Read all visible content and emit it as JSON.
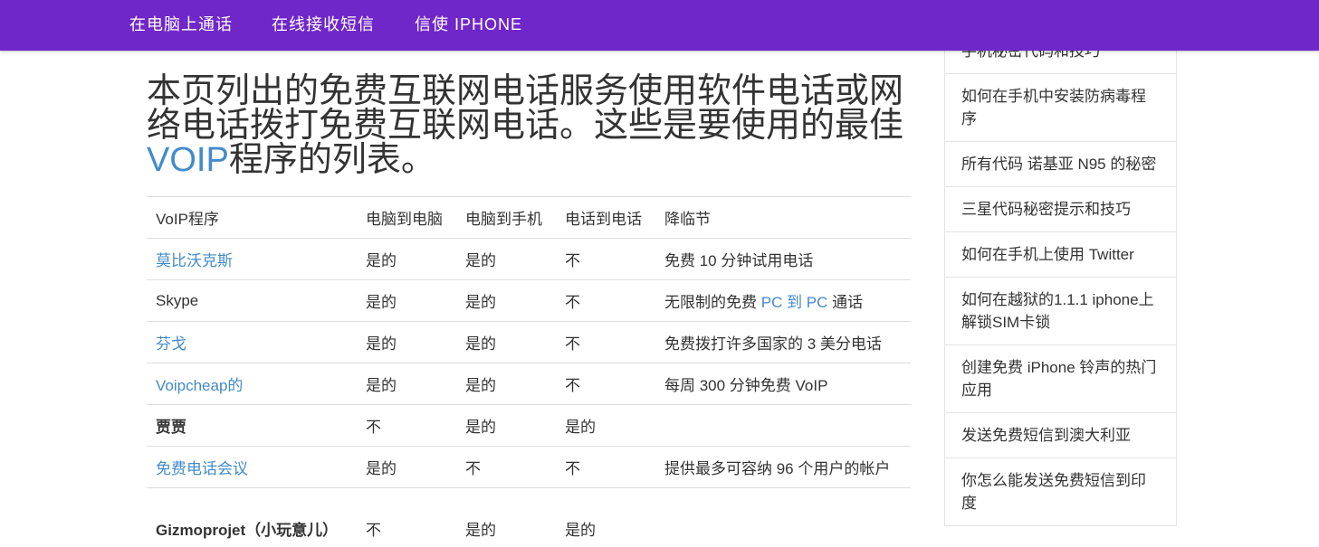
{
  "nav": {
    "items": [
      "在电脑上通话",
      "在线接收短信",
      "信使 IPHONE"
    ]
  },
  "heading": {
    "text_before": "本页列出的免费互联网电话服务使用软件电话或网络电话拨打免费互联网电话。这些是要使用的最佳",
    "link": "VOIP",
    "text_after": "程序的列表。"
  },
  "table": {
    "headers": [
      "VoIP程序",
      "电脑到电脑",
      "电脑到手机",
      "电话到电话",
      "降临节"
    ],
    "rows": [
      {
        "program": "莫比沃克斯",
        "program_link": true,
        "bold": false,
        "pc_pc": "是的",
        "pc_phone": "是的",
        "phone_phone": "不",
        "note": "免费 10 分钟试用电话"
      },
      {
        "program": "Skype",
        "program_link": false,
        "bold": false,
        "pc_pc": "是的",
        "pc_phone": "是的",
        "phone_phone": "不",
        "note_before": "无限制的免费 ",
        "note_link": "PC 到 PC",
        "note_after": " 通话"
      },
      {
        "program": "芬戈",
        "program_link": true,
        "bold": false,
        "pc_pc": "是的",
        "pc_phone": "是的",
        "phone_phone": "不",
        "note": "免费拨打许多国家的 3 美分电话"
      },
      {
        "program": "Voipcheap的",
        "program_link": true,
        "bold": false,
        "pc_pc": "是的",
        "pc_phone": "是的",
        "phone_phone": "不",
        "note": "每周 300 分钟免费 VoIP"
      },
      {
        "program": "贾贾",
        "program_link": false,
        "bold": true,
        "pc_pc": "不",
        "pc_phone": "是的",
        "phone_phone": "是的",
        "note": ""
      },
      {
        "program": "免费电话会议",
        "program_link": true,
        "bold": false,
        "pc_pc": "是的",
        "pc_phone": "不",
        "phone_phone": "不",
        "note": "提供最多可容纳 96 个用户的帐户"
      },
      {
        "program": "Gizmoprojet（小玩意儿）",
        "program_link": false,
        "bold": true,
        "pc_pc": "不",
        "pc_phone": "是的",
        "phone_phone": "是的",
        "note": ""
      }
    ]
  },
  "sidebar": {
    "items": [
      "手机秘密代码和技巧",
      "如何在手机中安装防病毒程序",
      "所有代码 诺基亚 N95 的秘密",
      "三星代码秘密提示和技巧",
      "如何在手机上使用 Twitter",
      "如何在越狱的1.1.1 iphone上解锁SIM卡锁",
      "创建免费 iPhone 铃声的热门应用",
      "发送免费短信到澳大利亚",
      "你怎么能发送免费短信到印度"
    ]
  },
  "colors": {
    "navbar": "#7027c9",
    "link": "#428bca",
    "text": "#333333"
  }
}
